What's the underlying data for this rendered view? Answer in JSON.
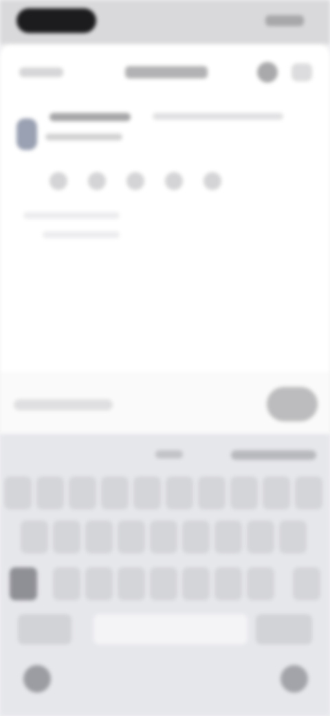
{
  "status_bar": {
    "time": "",
    "indicators": ""
  },
  "header": {
    "cancel_label": "",
    "title": "",
    "icons": [
      "settings-icon",
      "menu-icon"
    ]
  },
  "post": {
    "author_name": "",
    "handle": "",
    "subtitle": "",
    "rating_icons": [
      "star-icon",
      "star-icon",
      "star-icon",
      "star-icon",
      "star-icon"
    ]
  },
  "composer": {
    "placeholder": "",
    "send_label": ""
  },
  "keyboard": {
    "suggestions": [
      "",
      ""
    ],
    "space_label": "",
    "return_label": ""
  },
  "colors": {
    "sheet": "#ffffff",
    "keyboard": "#e6e7eb",
    "status": "#d9d9db"
  }
}
